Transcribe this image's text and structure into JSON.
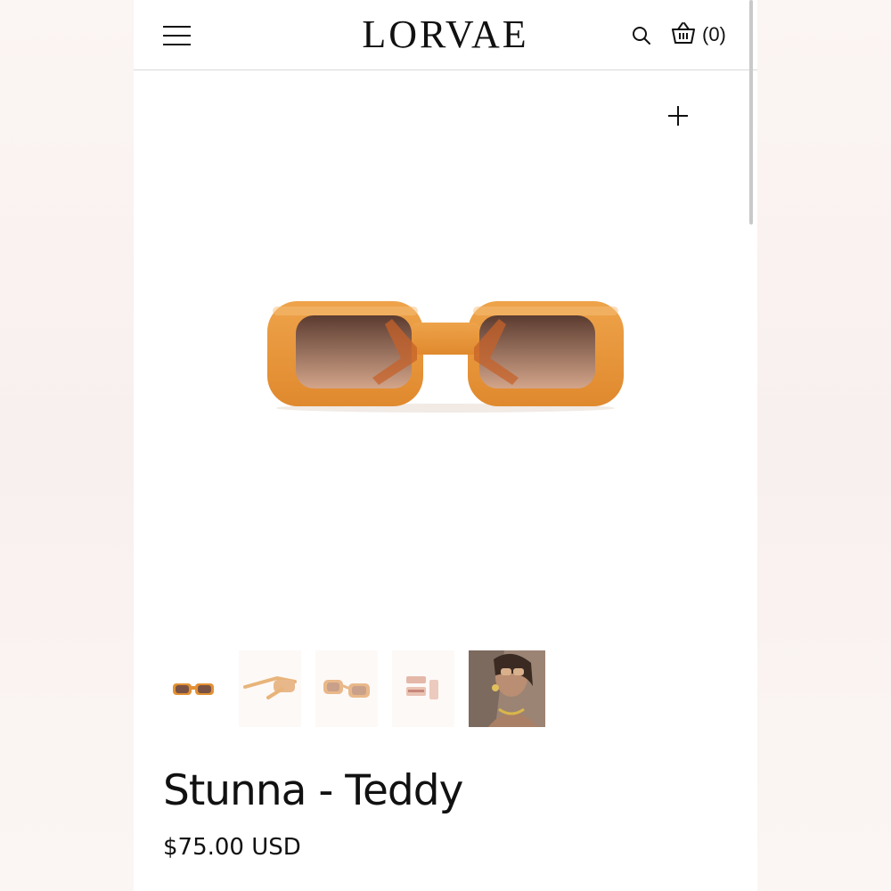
{
  "header": {
    "brand": "LORVAE",
    "cart_count": "(0)",
    "menu_icon": "hamburger-menu-icon",
    "search_icon": "search-icon",
    "cart_icon": "basket-icon"
  },
  "gallery": {
    "zoom_icon": "plus-icon",
    "main_image": "orange rectangular sunglasses with brown gradient lenses",
    "thumbnails": [
      "sunglasses-front-thumbnail",
      "sunglasses-side-thumbnail",
      "sunglasses-angle-thumbnail",
      "sunglasses-case-thumbnail",
      "model-wearing-sunglasses-thumbnail"
    ]
  },
  "product": {
    "title": "Stunna - Teddy",
    "price": "$75.00 USD"
  },
  "colors": {
    "frame": "#e89a3c",
    "frame_dark": "#d98526",
    "lens_top": "#5b3b30",
    "lens_bottom": "#c8977a",
    "text": "#111111",
    "divider": "#d9d9d9"
  }
}
